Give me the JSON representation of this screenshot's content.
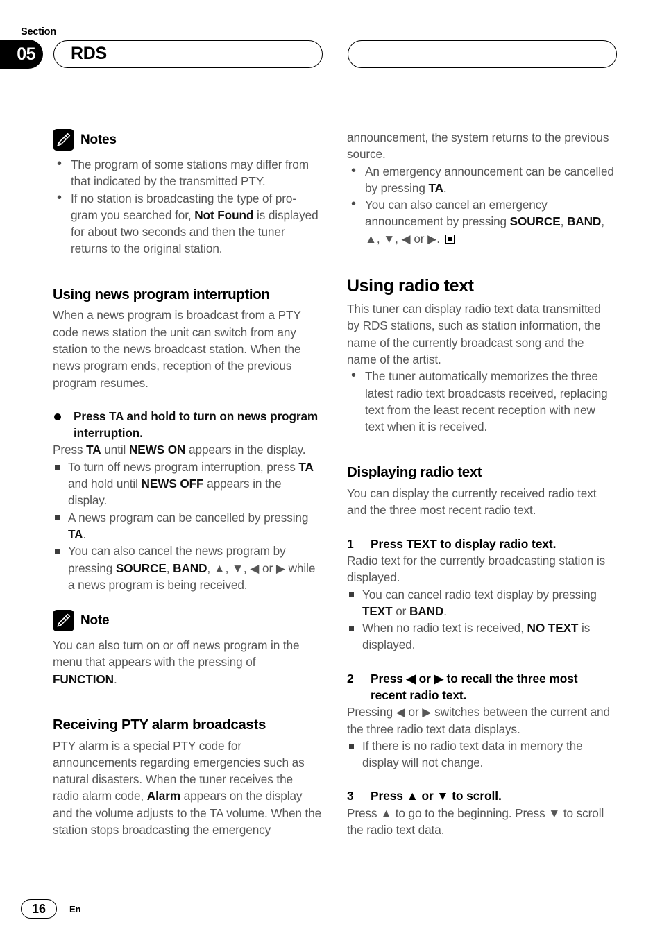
{
  "header": {
    "section_label": "Section",
    "section_number": "05",
    "left_pill_title": "RDS",
    "right_pill_title": ""
  },
  "footer": {
    "page_number": "16",
    "language": "En"
  },
  "left_column": {
    "notes_block": {
      "icon": "pencil-icon",
      "title": "Notes",
      "items": [
        "The program of some stations may differ from that indicated by the transmitted PTY.",
        "If no station is broadcasting the type of program you searched for, Not Found is displayed for about two seconds and then the tuner returns to the original station."
      ],
      "item2_parts": {
        "a": "If no station is broadcasting the type of pro-gram you searched for, ",
        "bold": "Not Found",
        "b": " is displayed for about two seconds and then the tuner returns to the original station."
      }
    },
    "section1": {
      "heading": "Using news program interruption",
      "intro": "When a news program is broadcast from a PTY code news station the unit can switch from any station to the news broadcast station. When the news program ends, reception of the previous program resumes.",
      "action": {
        "bold_heading": "Press TA and hold to turn on news program interruption.",
        "body_a": "Press ",
        "body_b1": "TA",
        "body_c": " until ",
        "body_b2": "NEWS ON",
        "body_d": " appears in the display."
      },
      "sub_items": [
        {
          "a": "To turn off news program interruption, press ",
          "b1": "TA",
          "c": " and hold until ",
          "b2": "NEWS OFF",
          "d": " appears in the display."
        },
        {
          "a": "A news program can be cancelled by pressing ",
          "b1": "TA",
          "c": ".",
          "b2": "",
          "d": ""
        },
        {
          "a": "You can also cancel the news program by pressing ",
          "b1": "SOURCE",
          "c": ", ",
          "b2": "BAND",
          "d": ", ▲, ▼, ◀ or ▶ while a news program is being received."
        }
      ]
    },
    "note_block": {
      "icon": "pencil-icon",
      "title": "Note",
      "text_a": "You can also turn on or off news program in the menu that appears with the pressing of ",
      "text_bold": "FUNCTION",
      "text_b": "."
    },
    "section2": {
      "heading": "Receiving PTY alarm broadcasts",
      "body_a": "PTY alarm is a special PTY code for announcements regarding emergencies such as natural disasters. When the tuner receives the radio alarm code, ",
      "body_bold": "Alarm",
      "body_b": " appears on the display and the volume adjusts to the TA volume. When the station stops broadcasting the emergency"
    }
  },
  "right_column": {
    "continuation": {
      "text": "announcement, the system returns to the previous source.",
      "bullets": [
        {
          "a": "An emergency announcement can be cancelled by pressing ",
          "b1": "TA",
          "c": ".",
          "b2": "",
          "d": "",
          "eos": false
        },
        {
          "a": "You can also cancel an emergency announcement by pressing ",
          "b1": "SOURCE",
          "c": ", ",
          "b2": "BAND",
          "d": ", ▲, ▼, ◀ or ▶. ",
          "eos": true
        }
      ]
    },
    "section1": {
      "heading": "Using radio text",
      "intro": "This tuner can display radio text data transmitted by RDS stations, such as station information, the name of the currently broadcast song and the name of the artist.",
      "bullets": [
        "The tuner automatically memorizes the three latest radio text broadcasts received, replacing text from the least recent reception with new text when it is received."
      ]
    },
    "section2": {
      "heading": "Displaying radio text",
      "intro": "You can display the currently received radio text and the three most recent radio text.",
      "steps": [
        {
          "num": "1",
          "title": "Press TEXT to display radio text.",
          "body": "Radio text for the currently broadcasting station is displayed.",
          "sub_items": [
            {
              "a": "You can cancel radio text display by pressing ",
              "b1": "TEXT",
              "c": " or ",
              "b2": "BAND",
              "d": "."
            },
            {
              "a": "When no radio text is received, ",
              "b1": "NO TEXT",
              "c": " is displayed.",
              "b2": "",
              "d": ""
            }
          ]
        },
        {
          "num": "2",
          "title": "Press ◀ or ▶ to recall the three most recent radio text.",
          "body": "Pressing ◀ or ▶ switches between the current and the three radio text data displays.",
          "sub_items": [
            {
              "a": "If there is no radio text data in memory the display will not change.",
              "b1": "",
              "c": "",
              "b2": "",
              "d": ""
            }
          ]
        },
        {
          "num": "3",
          "title": "Press ▲ or ▼ to scroll.",
          "body": "Press ▲ to go to the beginning. Press ▼ to scroll the radio text data.",
          "sub_items": []
        }
      ]
    }
  }
}
